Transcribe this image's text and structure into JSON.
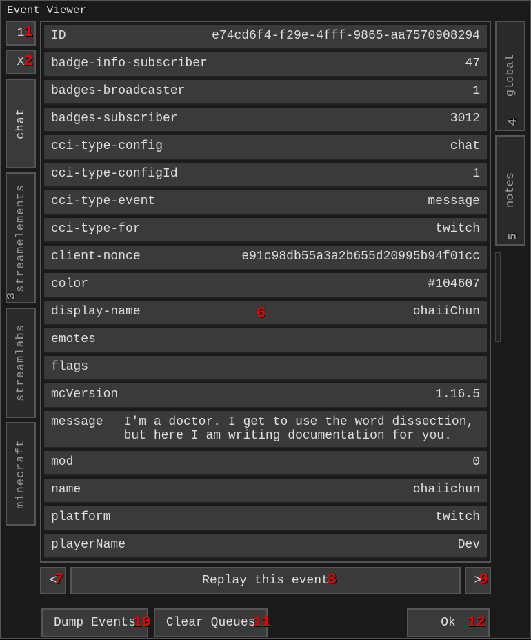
{
  "title": "Event Viewer",
  "left_tabs": {
    "small": [
      {
        "label": "1"
      },
      {
        "label": "X"
      }
    ],
    "vertical": [
      {
        "label": "chat",
        "active": true
      },
      {
        "label": "streamelements",
        "active": false
      },
      {
        "label": "streamlabs",
        "active": false
      },
      {
        "label": "minecraft",
        "active": false
      }
    ]
  },
  "right_tabs": [
    {
      "label": "global"
    },
    {
      "label": "notes"
    }
  ],
  "rows": [
    {
      "key": "ID",
      "val": "e74cd6f4-f29e-4fff-9865-aa7570908294"
    },
    {
      "key": "badge-info-subscriber",
      "val": "47"
    },
    {
      "key": "badges-broadcaster",
      "val": "1"
    },
    {
      "key": "badges-subscriber",
      "val": "3012"
    },
    {
      "key": "cci-type-config",
      "val": "chat"
    },
    {
      "key": "cci-type-configId",
      "val": "1"
    },
    {
      "key": "cci-type-event",
      "val": "message"
    },
    {
      "key": "cci-type-for",
      "val": "twitch"
    },
    {
      "key": "client-nonce",
      "val": "e91c98db55a3a2b655d20995b94f01cc"
    },
    {
      "key": "color",
      "val": "#104607"
    },
    {
      "key": "display-name",
      "val": "ohaiiChun"
    },
    {
      "key": "emotes",
      "val": ""
    },
    {
      "key": "flags",
      "val": ""
    },
    {
      "key": "mcVersion",
      "val": "1.16.5"
    },
    {
      "key": "message",
      "val": "I'm a doctor. I get to use the word dissection, but here I am writing documentation for you.",
      "msg": true
    },
    {
      "key": "mod",
      "val": "0"
    },
    {
      "key": "name",
      "val": "ohaiichun"
    },
    {
      "key": "platform",
      "val": "twitch"
    },
    {
      "key": "playerName",
      "val": "Dev"
    }
  ],
  "nav": {
    "prev": "<",
    "replay": "Replay this event",
    "next": ">"
  },
  "buttons": {
    "dump": "Dump Events",
    "clear": "Clear Queues",
    "ok": "Ok"
  },
  "markers": {
    "m1": "1",
    "m2": "2",
    "m3": "3",
    "m4": "4",
    "m5": "5",
    "m6": "6",
    "m7": "7",
    "m8": "8",
    "m9": "9",
    "m10": "10",
    "m11": "11",
    "m12": "12"
  }
}
